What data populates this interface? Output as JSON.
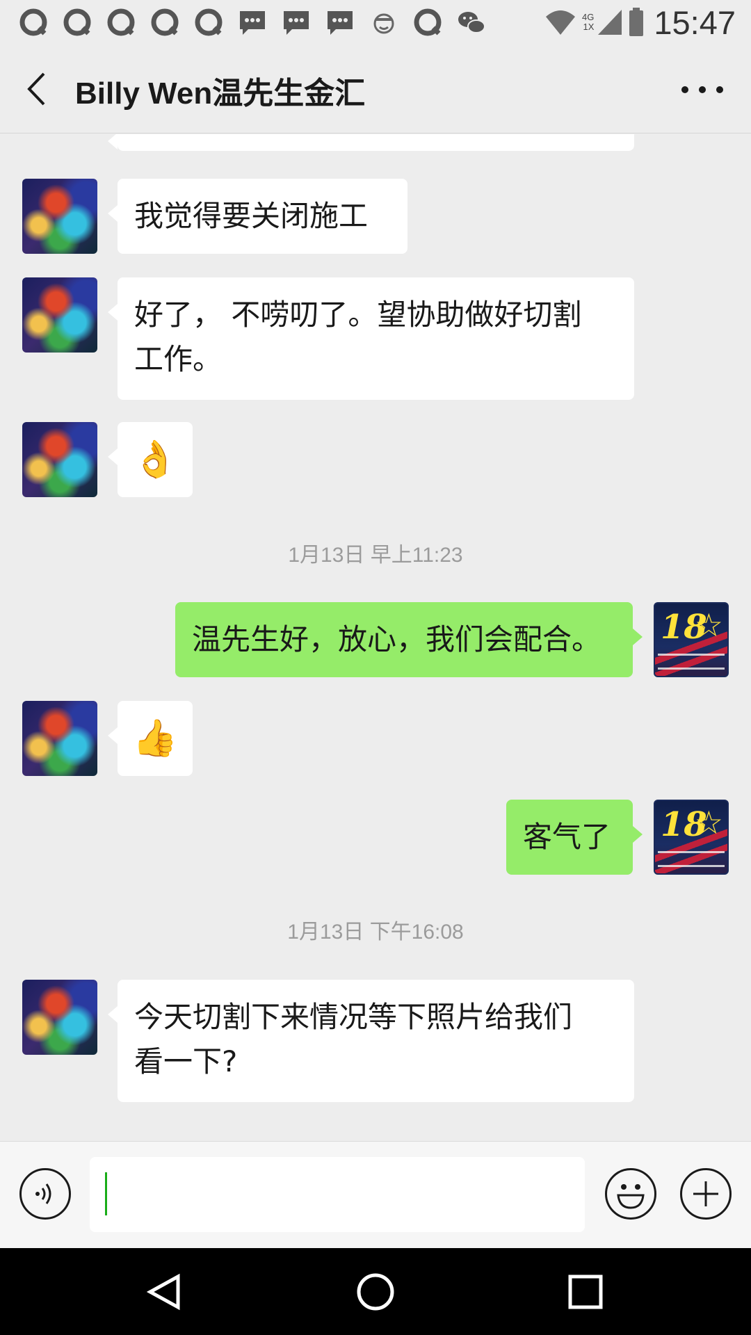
{
  "status_bar": {
    "time": "15:47",
    "network_label_top": "4G",
    "network_label_bottom": "1X",
    "notification_icons": [
      "qq-icon",
      "qq-icon",
      "qq-icon",
      "qq-icon",
      "qq-icon",
      "message-icon",
      "message-icon",
      "message-icon",
      "smiley-icon",
      "qq-icon",
      "wechat-icon"
    ]
  },
  "header": {
    "title": "Billy Wen温先生金汇"
  },
  "messages": [
    {
      "side": "them",
      "text": "我觉得要关闭施工"
    },
    {
      "side": "them",
      "text_line1": "好了， 不唠叨了。望协助做好切割",
      "text_line2": "工作。"
    },
    {
      "side": "them",
      "emoji": "👌"
    },
    {
      "time": "1月13日 早上11:23"
    },
    {
      "side": "me",
      "text": "温先生好，放心，我们会配合。"
    },
    {
      "side": "them",
      "emoji": "👍"
    },
    {
      "side": "me",
      "text": "客气了"
    },
    {
      "time": "1月13日 下午16:08"
    },
    {
      "side": "them",
      "text_line1": "今天切割下来情况等下照片给我们",
      "text_line2": "看一下?"
    }
  ],
  "avatar_me": {
    "number": "18"
  },
  "colors": {
    "background": "#ededed",
    "bubble_me": "#95ec69",
    "bubble_them": "#ffffff",
    "caret": "#1aad19"
  }
}
